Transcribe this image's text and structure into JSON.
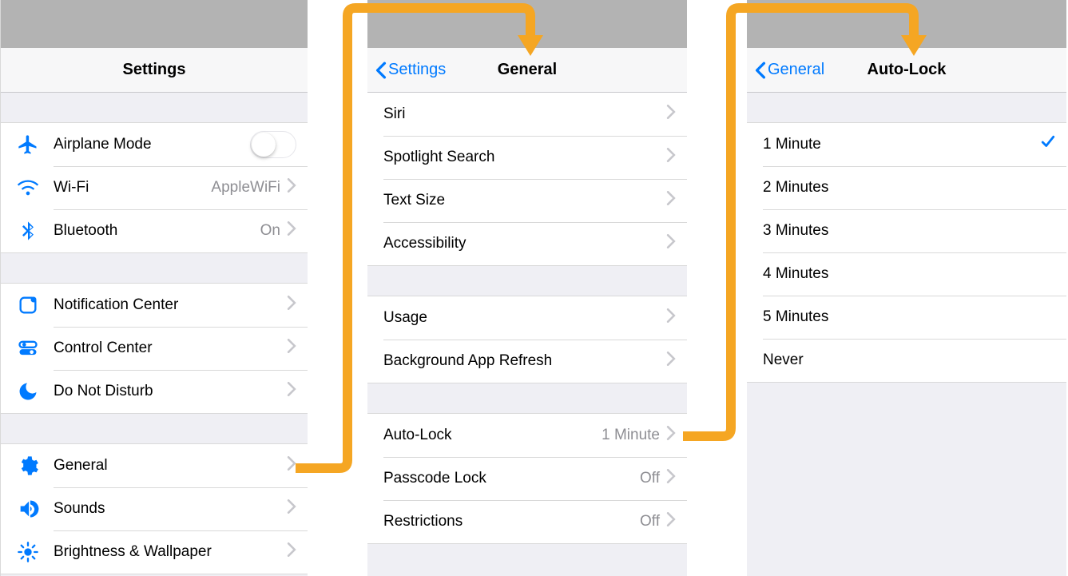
{
  "panel1": {
    "title": "Settings",
    "groups": [
      [
        {
          "icon": "airplane",
          "label": "Airplane Mode",
          "type": "toggle",
          "value": false
        },
        {
          "icon": "wifi",
          "label": "Wi-Fi",
          "detail": "AppleWiFi",
          "type": "chevron"
        },
        {
          "icon": "bluetooth",
          "label": "Bluetooth",
          "detail": "On",
          "type": "chevron"
        }
      ],
      [
        {
          "icon": "notification",
          "label": "Notification Center",
          "type": "chevron"
        },
        {
          "icon": "controlcenter",
          "label": "Control Center",
          "type": "chevron"
        },
        {
          "icon": "dnd",
          "label": "Do Not Disturb",
          "type": "chevron"
        }
      ],
      [
        {
          "icon": "general",
          "label": "General",
          "type": "chevron"
        },
        {
          "icon": "sounds",
          "label": "Sounds",
          "type": "chevron"
        },
        {
          "icon": "brightness",
          "label": "Brightness & Wallpaper",
          "type": "chevron"
        }
      ]
    ]
  },
  "panel2": {
    "back": "Settings",
    "title": "General",
    "groups": [
      [
        {
          "label": "Siri",
          "type": "chevron"
        },
        {
          "label": "Spotlight Search",
          "type": "chevron"
        },
        {
          "label": "Text Size",
          "type": "chevron"
        },
        {
          "label": "Accessibility",
          "type": "chevron"
        }
      ],
      [
        {
          "label": "Usage",
          "type": "chevron"
        },
        {
          "label": "Background App Refresh",
          "type": "chevron"
        }
      ],
      [
        {
          "label": "Auto-Lock",
          "detail": "1 Minute",
          "type": "chevron"
        },
        {
          "label": "Passcode Lock",
          "detail": "Off",
          "type": "chevron"
        },
        {
          "label": "Restrictions",
          "detail": "Off",
          "type": "chevron"
        }
      ]
    ]
  },
  "panel3": {
    "back": "General",
    "title": "Auto-Lock",
    "options": [
      {
        "label": "1 Minute",
        "selected": true
      },
      {
        "label": "2 Minutes",
        "selected": false
      },
      {
        "label": "3 Minutes",
        "selected": false
      },
      {
        "label": "4 Minutes",
        "selected": false
      },
      {
        "label": "5 Minutes",
        "selected": false
      },
      {
        "label": "Never",
        "selected": false
      }
    ]
  },
  "colors": {
    "accent": "#007aff",
    "arrow": "#f5a623"
  }
}
